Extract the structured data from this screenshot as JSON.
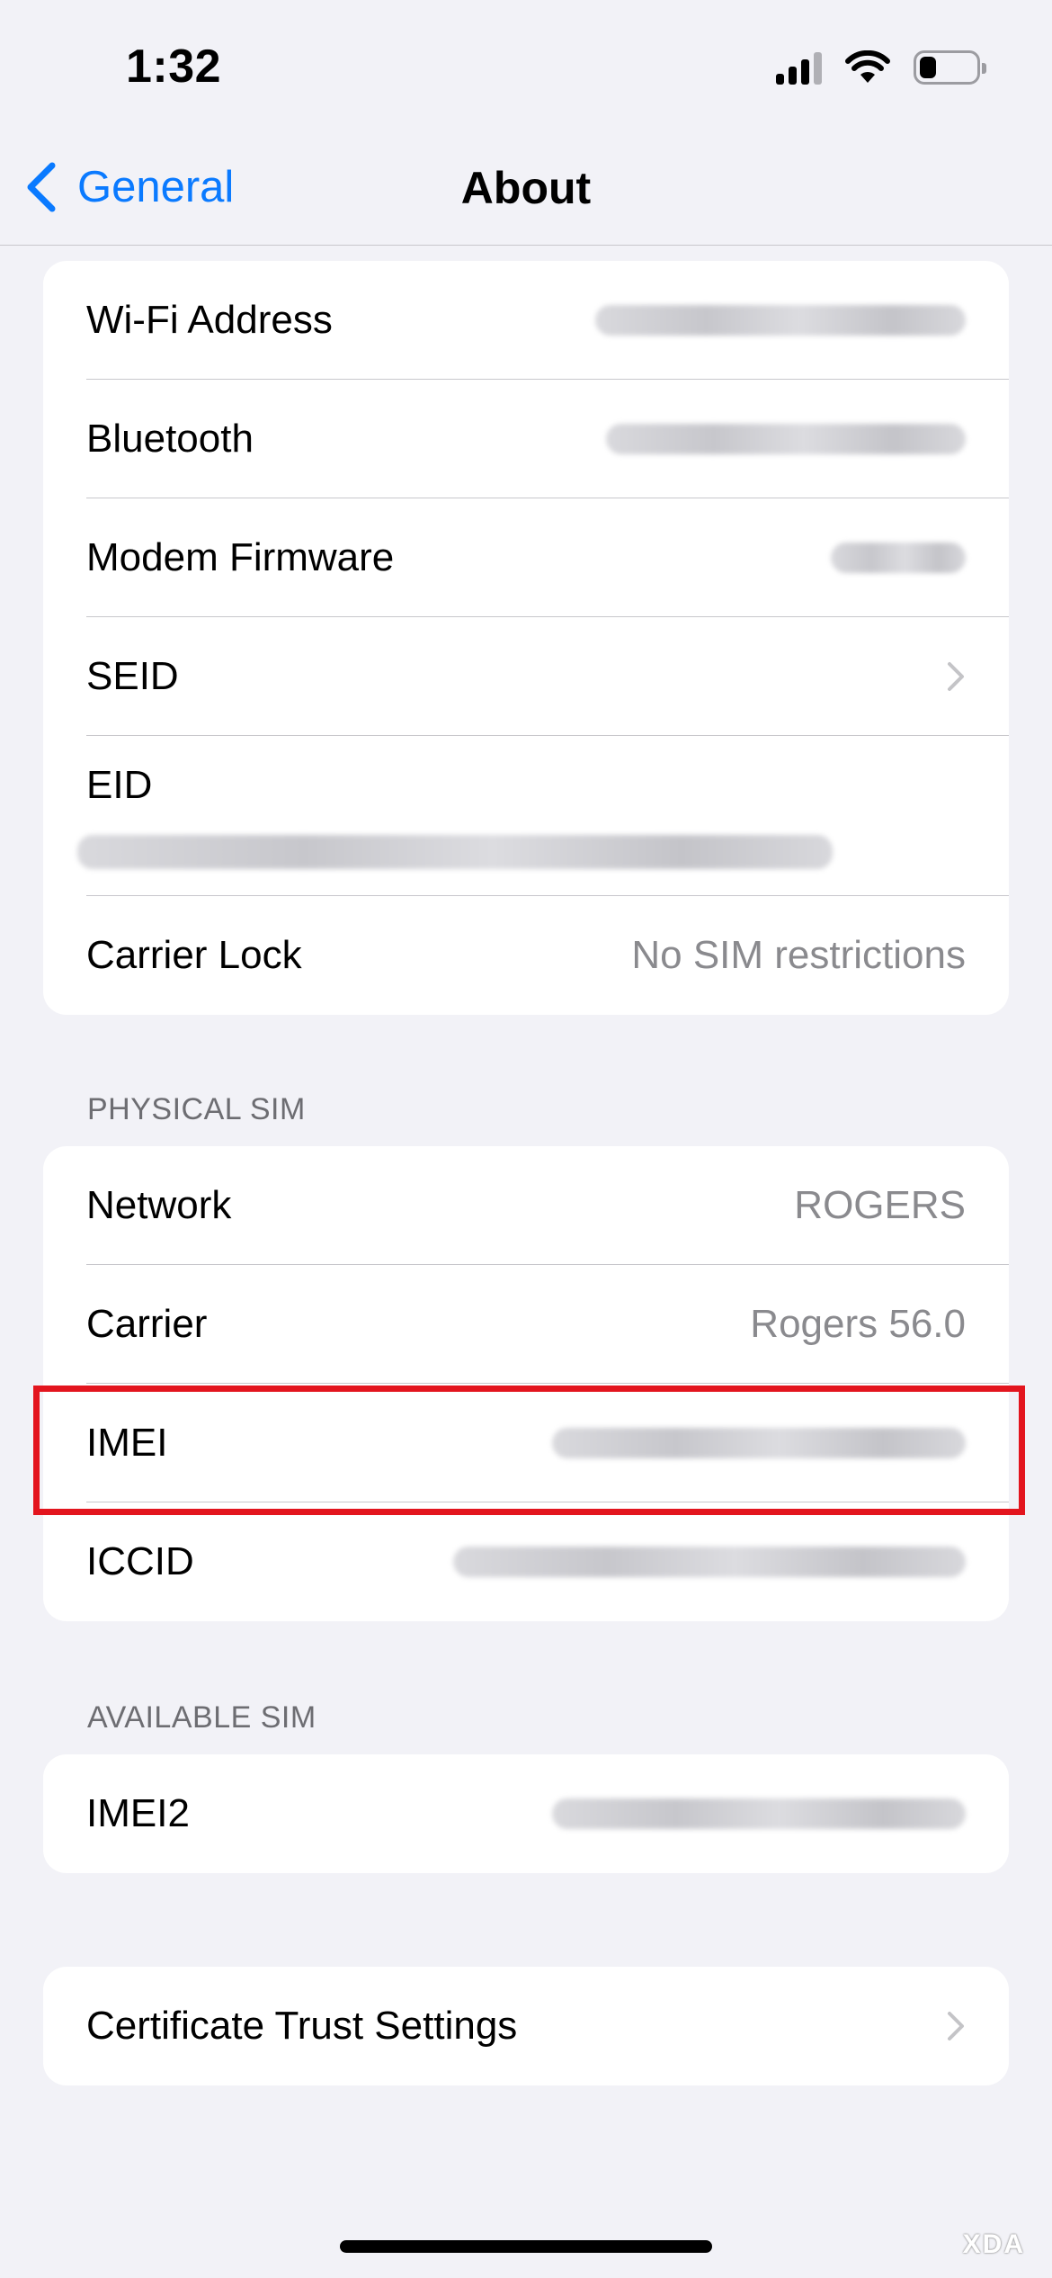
{
  "status_bar": {
    "time": "1:32",
    "signal_bars_filled": 3,
    "signal_bars_total": 4,
    "battery_level": 0.3
  },
  "nav": {
    "back_label": "General",
    "title": "About"
  },
  "device_group": {
    "rows": [
      {
        "label": "Wi-Fi Address",
        "value_redacted": true
      },
      {
        "label": "Bluetooth",
        "value_redacted": true
      },
      {
        "label": "Modem Firmware",
        "value_redacted": true
      },
      {
        "label": "SEID",
        "has_chevron": true
      },
      {
        "label": "EID",
        "value_redacted": true
      },
      {
        "label": "Carrier Lock",
        "value": "No SIM restrictions"
      }
    ]
  },
  "physical_sim": {
    "header": "PHYSICAL SIM",
    "rows": [
      {
        "label": "Network",
        "value": "ROGERS"
      },
      {
        "label": "Carrier",
        "value": "Rogers 56.0"
      },
      {
        "label": "IMEI",
        "value_redacted": true,
        "highlighted": true
      },
      {
        "label": "ICCID",
        "value_redacted": true
      }
    ]
  },
  "available_sim": {
    "header": "AVAILABLE SIM",
    "rows": [
      {
        "label": "IMEI2",
        "value_redacted": true
      }
    ]
  },
  "certificate_group": {
    "rows": [
      {
        "label": "Certificate Trust Settings",
        "has_chevron": true
      }
    ]
  },
  "watermark": "XDA",
  "colors": {
    "accent": "#0a7aff",
    "background": "#f2f2f7",
    "highlight": "#e3151e",
    "secondary_text": "#8a8a8e"
  },
  "icons": [
    "back-chevron-icon",
    "chevron-right-icon",
    "wifi-icon",
    "signal-icon",
    "battery-icon"
  ]
}
